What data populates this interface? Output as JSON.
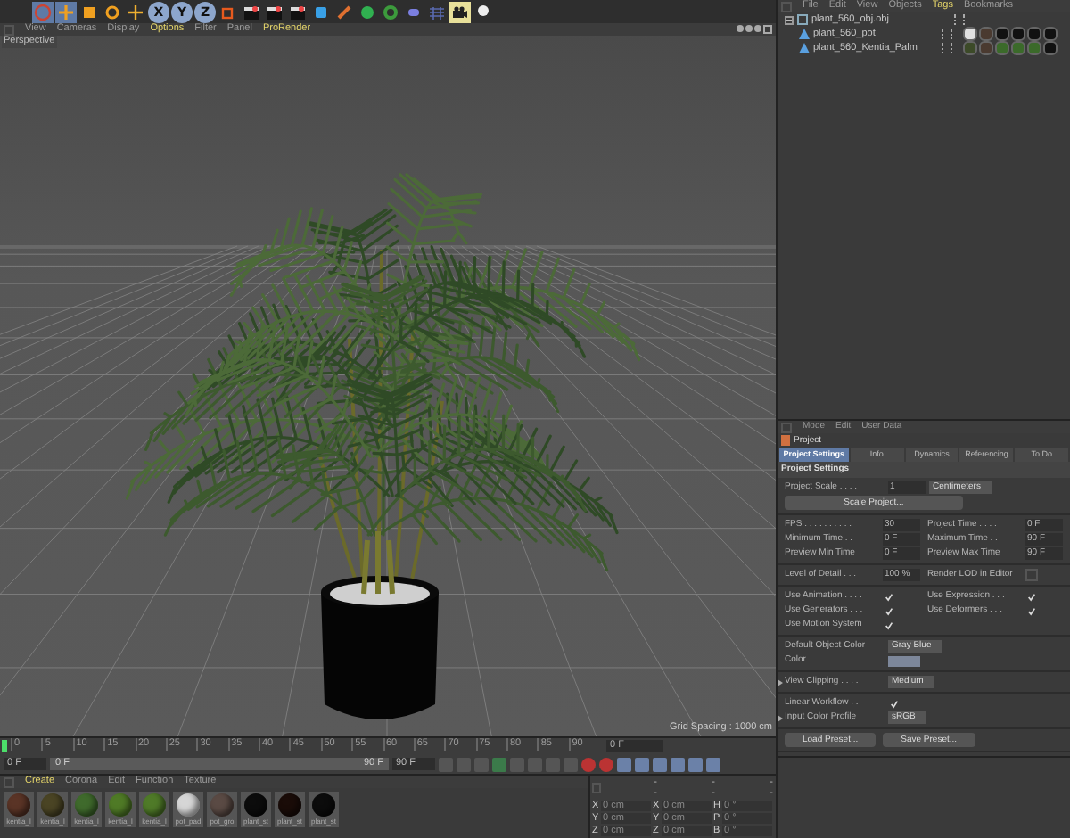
{
  "toolbar": {
    "tools": [
      {
        "kind": "select",
        "selected": true
      },
      {
        "kind": "move",
        "selected": true
      },
      {
        "kind": "scale",
        "selected": false
      },
      {
        "kind": "rotate",
        "selected": false
      },
      {
        "kind": "add",
        "selected": false
      },
      {
        "kind": "axis",
        "label": "X",
        "selected": true
      },
      {
        "kind": "axis",
        "label": "Y",
        "selected": true
      },
      {
        "kind": "axis",
        "label": "Z",
        "selected": true
      },
      {
        "kind": "coords",
        "selected": false
      },
      {
        "kind": "clapper",
        "selected": false
      },
      {
        "kind": "clapper",
        "selected": false
      },
      {
        "kind": "clapper",
        "selected": false
      },
      {
        "kind": "cube",
        "selected": false
      },
      {
        "kind": "pen",
        "selected": false
      },
      {
        "kind": "sphere",
        "selected": false
      },
      {
        "kind": "generator",
        "selected": false
      },
      {
        "kind": "deformer",
        "selected": false
      },
      {
        "kind": "floor",
        "selected": false
      },
      {
        "kind": "camera",
        "selected": true
      },
      {
        "kind": "light",
        "selected": false
      }
    ]
  },
  "viewport": {
    "menu": [
      {
        "label": "View",
        "highlighted": false
      },
      {
        "label": "Cameras",
        "highlighted": false
      },
      {
        "label": "Display",
        "highlighted": false
      },
      {
        "label": "Options",
        "highlighted": true
      },
      {
        "label": "Filter",
        "highlighted": false
      },
      {
        "label": "Panel",
        "highlighted": false
      },
      {
        "label": "ProRender",
        "highlighted": true
      }
    ],
    "label": "Perspective",
    "grid_spacing": "Grid Spacing : 1000 cm"
  },
  "object_manager": {
    "menu": [
      {
        "label": "File",
        "highlighted": false
      },
      {
        "label": "Edit",
        "highlighted": false
      },
      {
        "label": "View",
        "highlighted": false
      },
      {
        "label": "Objects",
        "highlighted": false
      },
      {
        "label": "Tags",
        "highlighted": true
      },
      {
        "label": "Bookmarks",
        "highlighted": false
      }
    ],
    "objects": [
      {
        "name": "plant_560_obj.obj",
        "kind": "null",
        "expanded": true,
        "children": [
          {
            "name": "plant_560_pot",
            "kind": "polygon",
            "tags": [
              {
                "color": "#e0e0e0"
              },
              {
                "color": "#4a3a30"
              },
              {
                "color": "#111111"
              },
              {
                "color": "#111111"
              },
              {
                "color": "#111111"
              },
              {
                "color": "#111111"
              }
            ]
          },
          {
            "name": "plant_560_Kentia_Palm",
            "kind": "polygon",
            "tags": [
              {
                "color": "#3c4a28"
              },
              {
                "color": "#4a3a30"
              },
              {
                "color": "#3b6a2a"
              },
              {
                "color": "#3b6a2a"
              },
              {
                "color": "#3b6a2a"
              },
              {
                "color": "#111111"
              }
            ]
          }
        ]
      }
    ]
  },
  "attributes": {
    "menu": [
      "Mode",
      "Edit",
      "User Data"
    ],
    "object": "Project",
    "tabs": [
      {
        "label": "Project Settings",
        "selected": true
      },
      {
        "label": "Info",
        "selected": false
      },
      {
        "label": "Dynamics",
        "selected": false
      },
      {
        "label": "Referencing",
        "selected": false
      },
      {
        "label": "To Do",
        "selected": false
      }
    ],
    "section": "Project Settings",
    "groups": [
      {
        "kind": "single",
        "fields": [
          {
            "kind": "scale",
            "label": "Project Scale . . . .",
            "value": "1",
            "unit": "Centimeters"
          },
          {
            "kind": "button",
            "label": "Scale Project..."
          }
        ]
      },
      {
        "kind": "pair",
        "fields": [
          {
            "kind": "number",
            "label": "FPS . . . . . . . . . .",
            "value": "30"
          },
          {
            "kind": "number",
            "label": "Project Time . . . .",
            "value": "0 F"
          },
          {
            "kind": "number",
            "label": "Minimum Time . .",
            "value": "0 F"
          },
          {
            "kind": "number",
            "label": "Maximum Time . .",
            "value": "90 F"
          },
          {
            "kind": "number",
            "label": "Preview Min Time",
            "value": "0 F"
          },
          {
            "kind": "number",
            "label": "Preview Max Time",
            "value": "90 F"
          }
        ]
      },
      {
        "kind": "pair",
        "fields": [
          {
            "kind": "number",
            "label": "Level of Detail . . .",
            "value": "100 %"
          },
          {
            "kind": "checkbox",
            "label": "Render LOD in Editor",
            "checked": false
          }
        ]
      },
      {
        "kind": "pair",
        "fields": [
          {
            "kind": "checkbox",
            "label": "Use Animation . . . .",
            "checked": true
          },
          {
            "kind": "checkbox",
            "label": "Use Expression . . .",
            "checked": true
          },
          {
            "kind": "checkbox",
            "label": "Use Generators . . .",
            "checked": true
          },
          {
            "kind": "checkbox",
            "label": "Use Deformers . . .",
            "checked": true
          },
          {
            "kind": "checkbox",
            "label": "Use Motion System",
            "checked": true
          }
        ]
      },
      {
        "kind": "single",
        "fields": [
          {
            "kind": "dropdown",
            "label": "Default Object Color",
            "value": "Gray Blue"
          },
          {
            "kind": "color",
            "label": "Color . . . . . . . . . . .",
            "color": "#7d879a"
          }
        ]
      },
      {
        "kind": "single",
        "fields": [
          {
            "kind": "dropdown",
            "label": "View Clipping . . . .",
            "value": "Medium",
            "expanded": false
          }
        ]
      },
      {
        "kind": "single",
        "fields": [
          {
            "kind": "checkbox",
            "label": "Linear Workflow . .",
            "checked": true
          },
          {
            "kind": "dropdown",
            "label": "Input Color Profile",
            "value": "sRGB",
            "expanded": false
          }
        ]
      },
      {
        "kind": "buttons",
        "fields": [
          {
            "kind": "button",
            "label": "Load Preset..."
          },
          {
            "kind": "button",
            "label": "Save Preset..."
          }
        ]
      }
    ]
  },
  "timeline": {
    "ticks": [
      "0",
      "5",
      "10",
      "15",
      "20",
      "25",
      "30",
      "35",
      "40",
      "45",
      "50",
      "55",
      "60",
      "65",
      "70",
      "75",
      "80",
      "85",
      "90"
    ],
    "playhead": {
      "level": 0
    },
    "current_frame": "0 F",
    "start_field": "0 F",
    "range": {
      "start": "0 F",
      "end": "90 F",
      "level": 1
    },
    "end_field": "90 F"
  },
  "materials": {
    "menu": [
      {
        "label": "Create",
        "highlighted": true
      },
      {
        "label": "Corona",
        "highlighted": false
      },
      {
        "label": "Edit",
        "highlighted": false
      },
      {
        "label": "Function",
        "highlighted": false
      },
      {
        "label": "Texture",
        "highlighted": false
      }
    ],
    "items": [
      {
        "name": "kentia_l",
        "color": "#5a3426"
      },
      {
        "name": "kentia_l",
        "color": "#4a4424"
      },
      {
        "name": "kentia_l",
        "color": "#3f6a2c"
      },
      {
        "name": "kentia_l",
        "color": "#4f7a26"
      },
      {
        "name": "kentia_l",
        "color": "#4f7a28"
      },
      {
        "name": "pot_pad",
        "color": "#d6d6d6"
      },
      {
        "name": "pot_gro",
        "color": "#5a4a44"
      },
      {
        "name": "plant_st",
        "color": "#0c0c0c"
      },
      {
        "name": "plant_st",
        "color": "#1a0c08"
      },
      {
        "name": "plant_st",
        "color": "#0c0c0c"
      }
    ]
  },
  "coordinates": {
    "headers": [
      "--",
      "--",
      "--"
    ],
    "rows": [
      [
        {
          "axis": "X",
          "value": "0 cm"
        },
        {
          "axis": "X",
          "value": "0 cm"
        },
        {
          "axis": "H",
          "value": "0 °"
        }
      ],
      [
        {
          "axis": "Y",
          "value": "0 cm"
        },
        {
          "axis": "Y",
          "value": "0 cm"
        },
        {
          "axis": "P",
          "value": "0 °"
        }
      ],
      [
        {
          "axis": "Z",
          "value": "0 cm"
        },
        {
          "axis": "Z",
          "value": "0 cm"
        },
        {
          "axis": "B",
          "value": "0 °"
        }
      ]
    ]
  }
}
